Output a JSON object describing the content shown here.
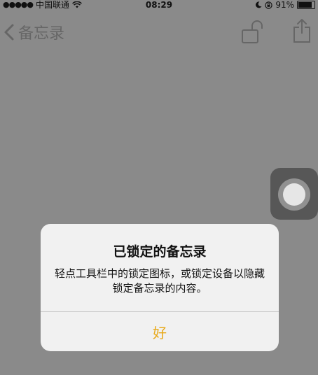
{
  "status_bar": {
    "signal": "●●●●●",
    "carrier": "中国联通",
    "time": "08:29",
    "battery": "91%"
  },
  "nav": {
    "back_label": "备忘录",
    "icons": [
      "chevron-left-icon",
      "unlock-icon",
      "share-icon"
    ]
  },
  "alert": {
    "title": "已锁定的备忘录",
    "message": "轻点工具栏中的锁定图标，或锁定设备以隐藏锁定备忘录的内容。",
    "button_label": "好",
    "button_color": "#e8a919"
  }
}
